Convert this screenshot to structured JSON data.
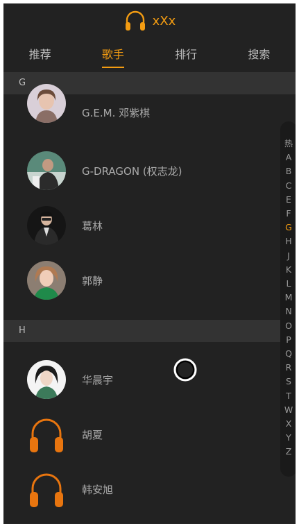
{
  "header": {
    "title": "xXx",
    "logo_icon": "headphones-icon",
    "accent_color": "#f39c12"
  },
  "tabs": [
    {
      "label": "推荐"
    },
    {
      "label": "歌手",
      "active": true
    },
    {
      "label": "排行"
    },
    {
      "label": "搜索"
    }
  ],
  "groups": [
    {
      "letter": "G",
      "singers": [
        {
          "name": "G.E.M. 邓紫棋",
          "avatar": "photo"
        },
        {
          "name": "G-DRAGON (权志龙)",
          "avatar": "photo"
        },
        {
          "name": "葛林",
          "avatar": "photo"
        },
        {
          "name": "郭静",
          "avatar": "photo"
        }
      ]
    },
    {
      "letter": "H",
      "singers": [
        {
          "name": "华晨宇",
          "avatar": "photo"
        },
        {
          "name": "胡夏",
          "avatar": "headphones-icon"
        },
        {
          "name": "韩安旭",
          "avatar": "headphones-icon"
        }
      ]
    }
  ],
  "index_bar": {
    "items": [
      "热",
      "A",
      "B",
      "C",
      "E",
      "F",
      "G",
      "H",
      "J",
      "K",
      "L",
      "M",
      "N",
      "O",
      "P",
      "Q",
      "R",
      "S",
      "T",
      "W",
      "X",
      "Y",
      "Z"
    ],
    "active": "G"
  }
}
